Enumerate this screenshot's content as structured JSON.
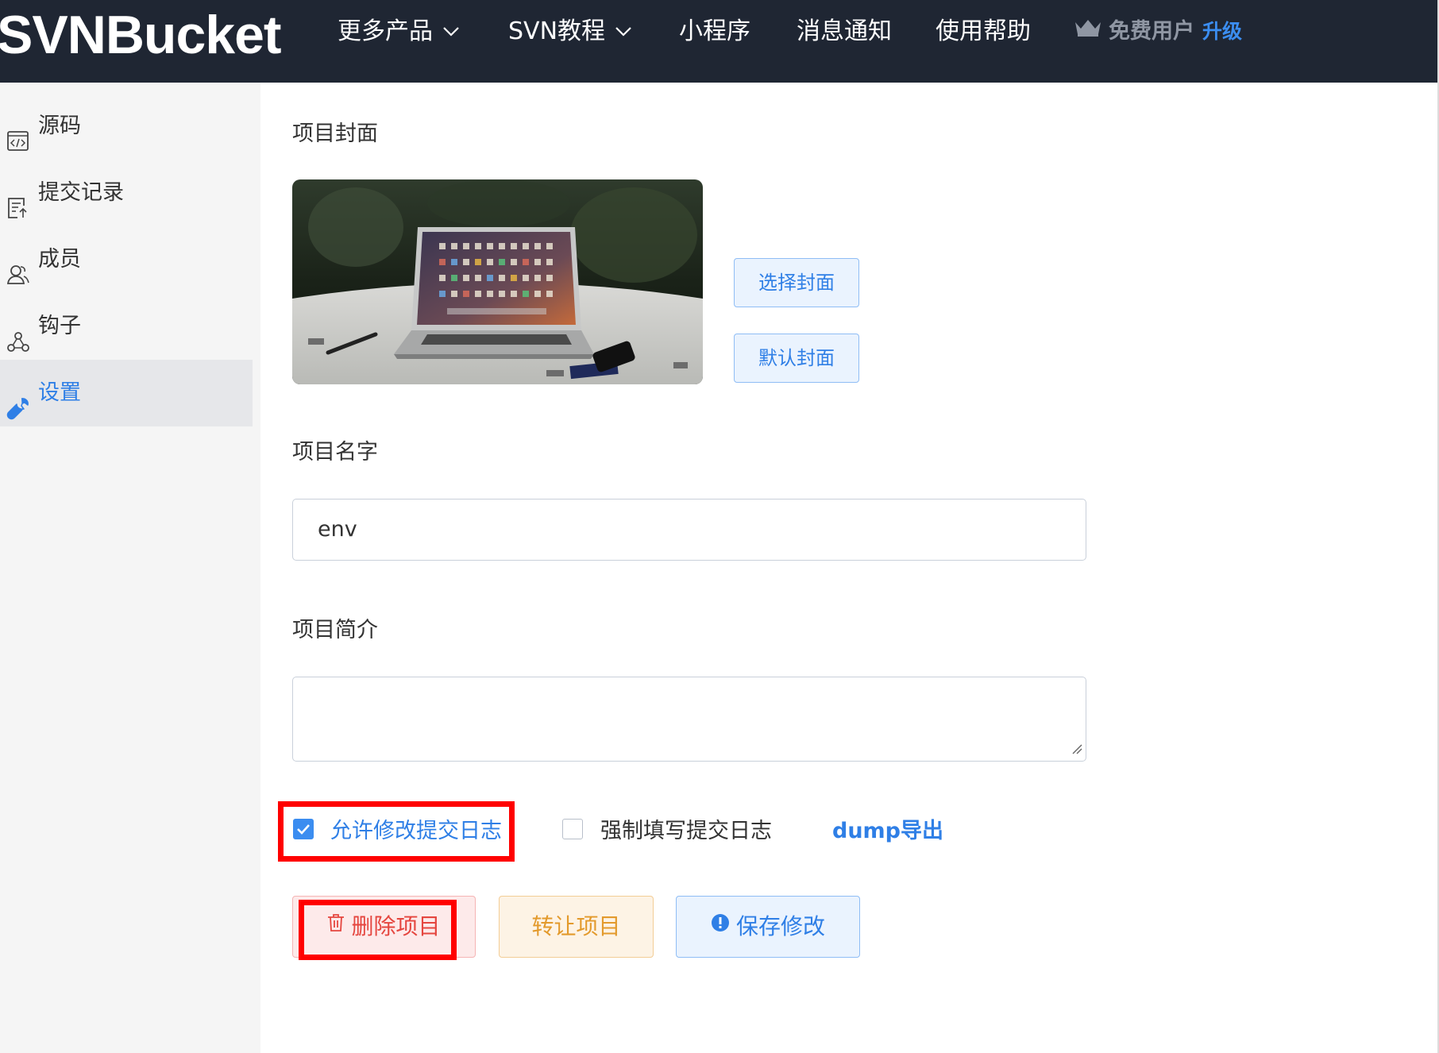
{
  "header": {
    "logo": "SVNBucket",
    "nav": [
      {
        "label": "更多产品",
        "dropdown": true
      },
      {
        "label": "SVN教程",
        "dropdown": true
      },
      {
        "label": "小程序",
        "dropdown": false
      },
      {
        "label": "消息通知",
        "dropdown": false
      },
      {
        "label": "使用帮助",
        "dropdown": false
      }
    ],
    "user": {
      "name": "免费用户",
      "upgrade": "升级",
      "icon": "crown-icon"
    }
  },
  "sidebar": {
    "items": [
      {
        "label": "源码",
        "icon": "code-file-icon",
        "active": false
      },
      {
        "label": "提交记录",
        "icon": "commit-log-icon",
        "active": false
      },
      {
        "label": "成员",
        "icon": "members-icon",
        "active": false
      },
      {
        "label": "钩子",
        "icon": "webhook-icon",
        "active": false
      },
      {
        "label": "设置",
        "icon": "wrench-icon",
        "active": true
      }
    ]
  },
  "settings": {
    "cover_label": "项目封面",
    "select_cover": "选择封面",
    "default_cover": "默认封面",
    "name_label": "项目名字",
    "name_value": "env",
    "desc_label": "项目简介",
    "desc_value": "",
    "allow_edit_log": {
      "label": "允许修改提交日志",
      "checked": true
    },
    "force_log": {
      "label": "强制填写提交日志",
      "checked": false
    },
    "dump_export": "dump导出",
    "delete_btn": "删除项目",
    "transfer_btn": "转让项目",
    "save_btn": "保存修改"
  },
  "colors": {
    "topbar": "#1f2633",
    "accent": "#2f7fe6",
    "danger": "#e5463f",
    "warning": "#e39a2c",
    "highlight": "#ff0000"
  }
}
